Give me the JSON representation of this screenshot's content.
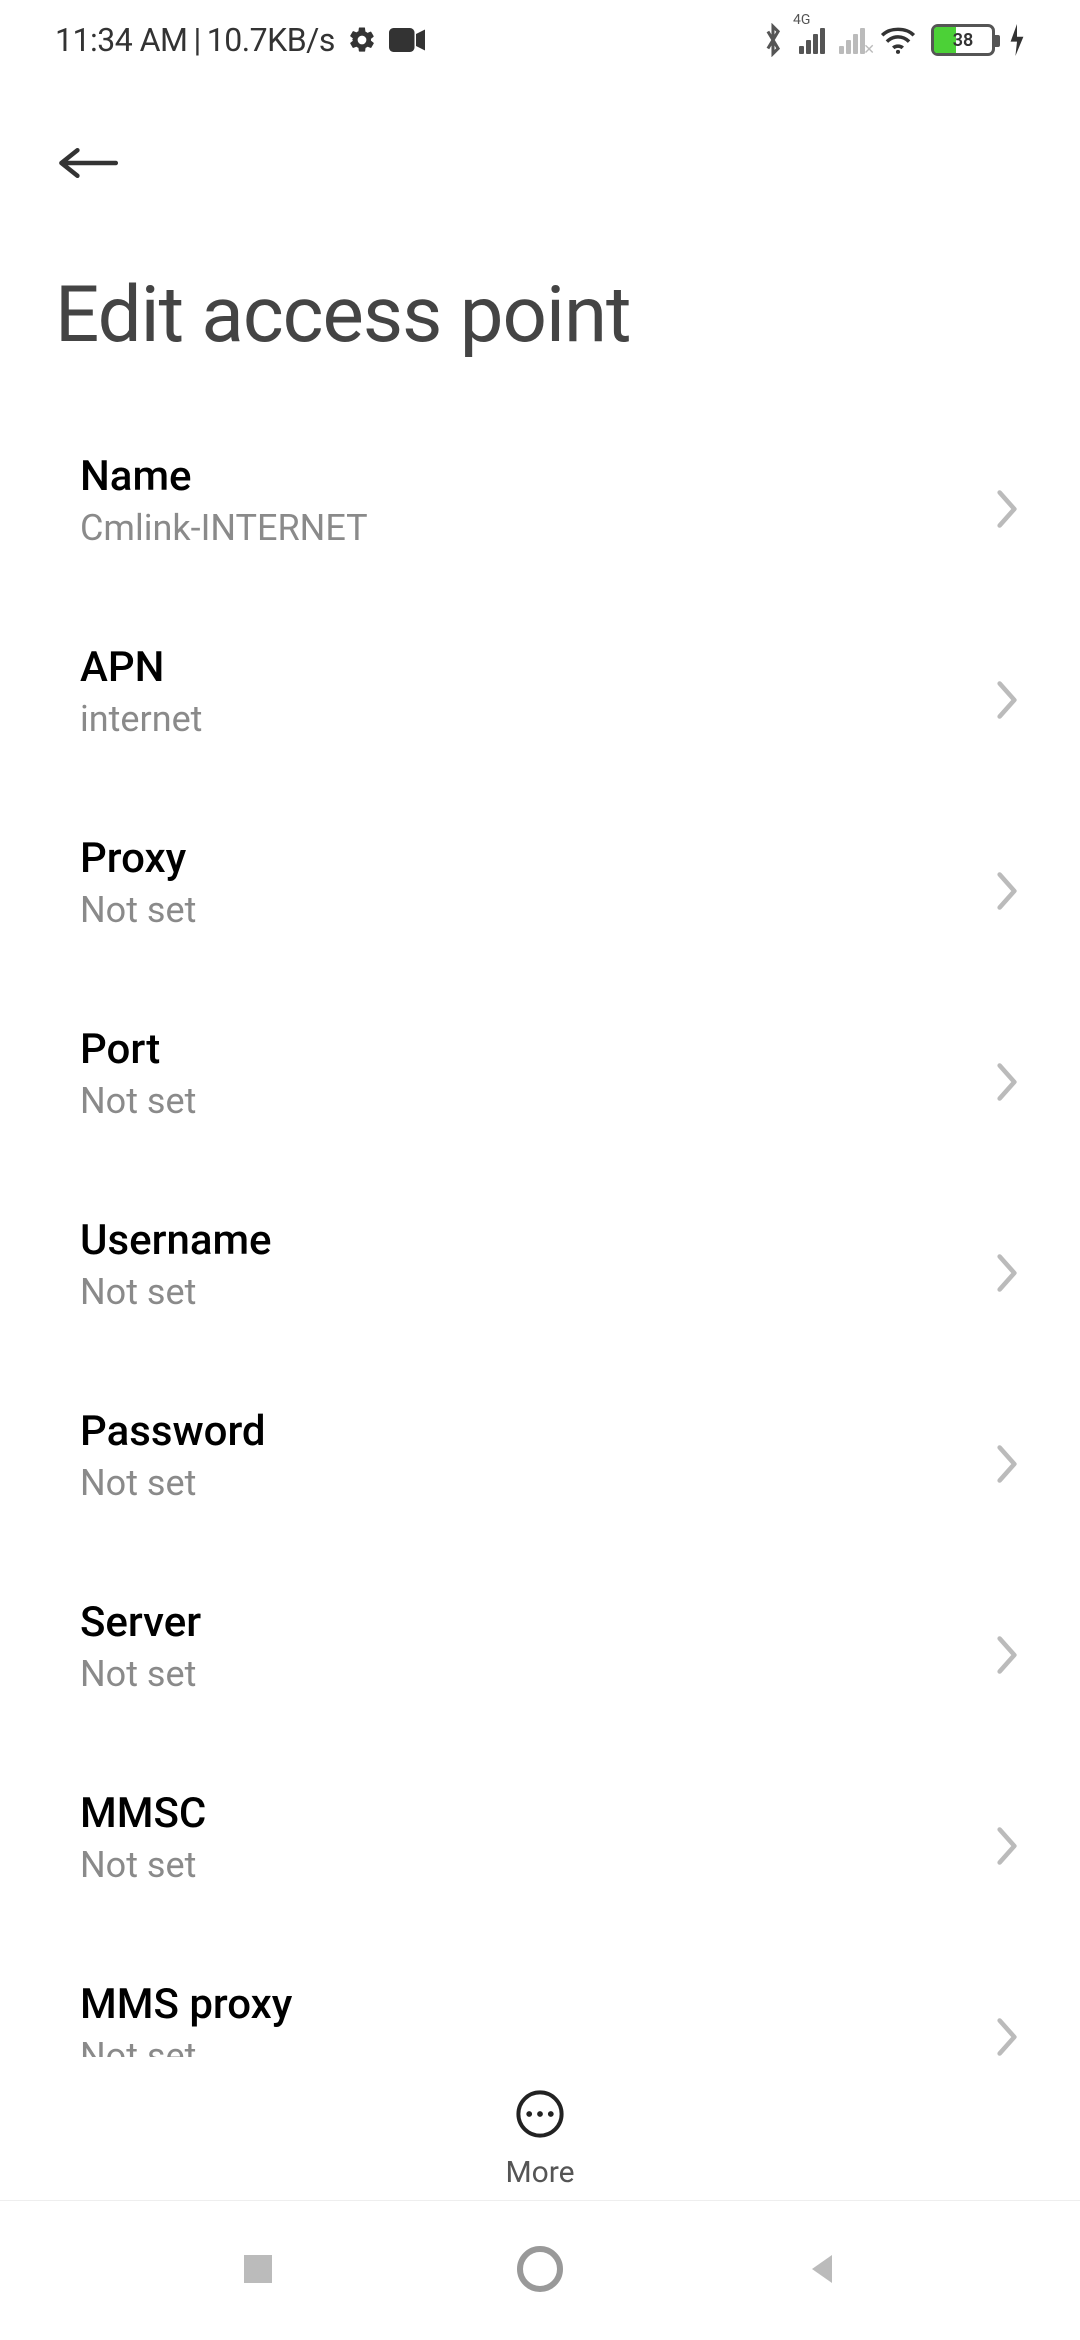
{
  "status": {
    "time": "11:34 AM",
    "separator": " | ",
    "net_speed": "10.7KB/s",
    "network_label": "4G",
    "battery_pct": "38"
  },
  "page_title": "Edit access point",
  "rows": [
    {
      "title": "Name",
      "value": "Cmlink-INTERNET"
    },
    {
      "title": "APN",
      "value": "internet"
    },
    {
      "title": "Proxy",
      "value": "Not set"
    },
    {
      "title": "Port",
      "value": "Not set"
    },
    {
      "title": "Username",
      "value": "Not set"
    },
    {
      "title": "Password",
      "value": "Not set"
    },
    {
      "title": "Server",
      "value": "Not set"
    },
    {
      "title": "MMSC",
      "value": "Not set"
    },
    {
      "title": "MMS proxy",
      "value": "Not set"
    }
  ],
  "more_label": "More"
}
